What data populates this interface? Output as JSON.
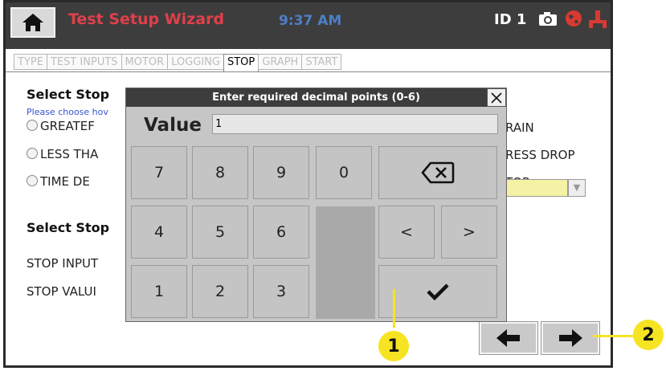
{
  "header": {
    "title": "Test Setup Wizard",
    "time": "9:37 AM",
    "id_label": "ID 1",
    "icons": [
      "home-icon",
      "camera-icon",
      "globe-icon",
      "network-icon"
    ]
  },
  "tabs": [
    {
      "label": "TYPE"
    },
    {
      "label": "TEST INPUTS"
    },
    {
      "label": "MOTOR"
    },
    {
      "label": "LOGGING"
    },
    {
      "label": "STOP",
      "active": true
    },
    {
      "label": "GRAPH"
    },
    {
      "label": "START"
    }
  ],
  "stop_page": {
    "heading1": "Select Stop",
    "hint": "Please choose hov",
    "options_left": [
      "GREATEF",
      "LESS THA",
      "TIME DE"
    ],
    "options_right": [
      "RAIN",
      "RESS DROP",
      "TOP"
    ],
    "heading2": "Select Stop",
    "stop_input_label": "STOP INPUT",
    "stop_value_label": "STOP VALUI"
  },
  "dialog": {
    "title": "Enter required decimal points (0-6)",
    "value_label": "Value",
    "value": "1"
  },
  "keypad": {
    "digits": [
      "7",
      "8",
      "9",
      "0",
      "4",
      "5",
      "6",
      "1",
      "2",
      "3"
    ],
    "less": "<",
    "greater": ">"
  },
  "callouts": {
    "one": "1",
    "two": "2"
  },
  "colors": {
    "topbar": "#3d3d3d",
    "title": "#e0404b",
    "clock": "#4e7fc8",
    "callout": "#f6e423",
    "input_highlight": "#f5f1a5"
  }
}
